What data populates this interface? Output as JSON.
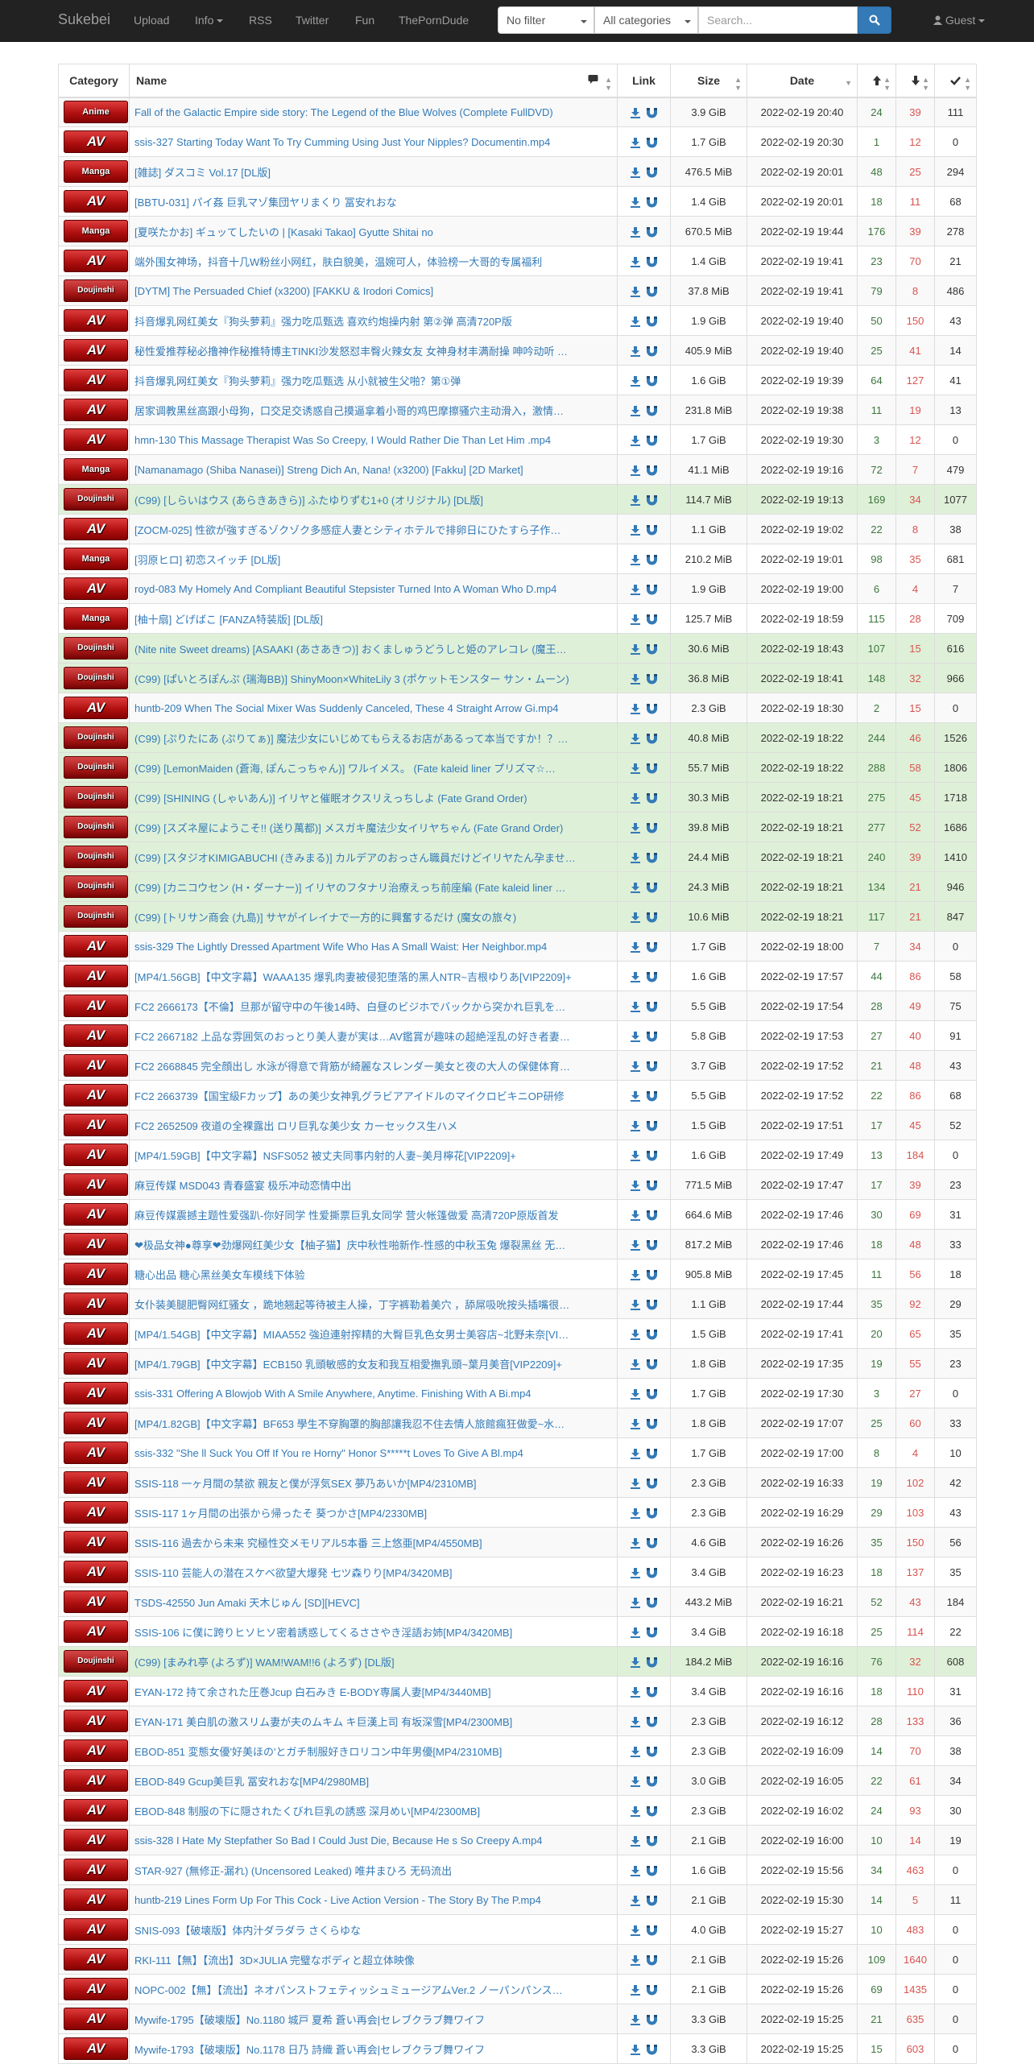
{
  "nav": {
    "brand": "Sukebei",
    "links": [
      "Upload",
      "Info",
      "RSS",
      "Twitter",
      "Fun",
      "ThePornDude"
    ],
    "filter": "No filter",
    "category": "All categories",
    "search_placeholder": "Search...",
    "user": "Guest"
  },
  "headers": {
    "category": "Category",
    "name": "Name",
    "link": "Link",
    "size": "Size",
    "date": "Date"
  },
  "colors": {
    "seeders": "#3c763d",
    "leechers": "#d9534f",
    "link": "#337ab7",
    "trusted_row": "#dff0d8"
  },
  "rows": [
    {
      "cat": "Anime",
      "name": "Fall of the Galactic Empire side story: The Legend of the Blue Wolves (Complete FullDVD)",
      "size": "3.9 GiB",
      "date": "2022-02-19 20:40",
      "s": "24",
      "l": "39",
      "c": "111",
      "trusted": false
    },
    {
      "cat": "AV",
      "name": "ssis-327 Starting Today Want To Try Cumming Using Just Your Nipples? Documentin.mp4",
      "size": "1.7 GiB",
      "date": "2022-02-19 20:30",
      "s": "1",
      "l": "12",
      "c": "0",
      "trusted": false
    },
    {
      "cat": "Manga",
      "name": "[雑誌] ダスコミ Vol.17 [DL版]",
      "size": "476.5 MiB",
      "date": "2022-02-19 20:01",
      "s": "48",
      "l": "25",
      "c": "294",
      "trusted": false
    },
    {
      "cat": "AV",
      "name": "[BBTU-031] パイ姦 巨乳マゾ集団ヤリまくり 冨安れおな",
      "size": "1.4 GiB",
      "date": "2022-02-19 20:01",
      "s": "18",
      "l": "11",
      "c": "68",
      "trusted": false
    },
    {
      "cat": "Manga",
      "name": "[夏咲たかお] ギュッてしたいの | [Kasaki Takao] Gyutte Shitai no",
      "size": "670.5 MiB",
      "date": "2022-02-19 19:44",
      "s": "176",
      "l": "39",
      "c": "278",
      "trusted": false
    },
    {
      "cat": "AV",
      "name": "端外围女神场，抖音十几W粉丝小网红，肤白貌美，温婉可人，体验榜一大哥的专属福利",
      "size": "1.4 GiB",
      "date": "2022-02-19 19:41",
      "s": "23",
      "l": "70",
      "c": "21",
      "trusted": false
    },
    {
      "cat": "Doujinshi",
      "name": "[DYTM] The Persuaded Chief (x3200) [FAKKU & Irodori Comics]",
      "size": "37.8 MiB",
      "date": "2022-02-19 19:41",
      "s": "79",
      "l": "8",
      "c": "486",
      "trusted": false
    },
    {
      "cat": "AV",
      "name": "抖音爆乳网红美女『狗头萝莉』强力吃瓜甄选 喜欢约炮操内射 第②弹 高清720P版",
      "size": "1.9 GiB",
      "date": "2022-02-19 19:40",
      "s": "50",
      "l": "150",
      "c": "43",
      "trusted": false
    },
    {
      "cat": "AV",
      "name": "秘性爱推荐秘必撸神作秘推特博主TINKI沙发怒怼丰臀火辣女友 女神身材丰满耐操 呻吟动听 …",
      "size": "405.9 MiB",
      "date": "2022-02-19 19:40",
      "s": "25",
      "l": "41",
      "c": "14",
      "trusted": false
    },
    {
      "cat": "AV",
      "name": "抖音爆乳网红美女『狗头萝莉』强力吃瓜甄选 从小就被生父啪？第①弹",
      "size": "1.6 GiB",
      "date": "2022-02-19 19:39",
      "s": "64",
      "l": "127",
      "c": "41",
      "trusted": false
    },
    {
      "cat": "AV",
      "name": "居家调教黑丝高跟小母狗，口交足交诱惑自己摸逼拿着小哥的鸡巴摩擦骚穴主动滑入，激情…",
      "size": "231.8 MiB",
      "date": "2022-02-19 19:38",
      "s": "11",
      "l": "19",
      "c": "13",
      "trusted": false
    },
    {
      "cat": "AV",
      "name": "hmn-130 This Massage Therapist Was So Creepy, I Would Rather Die Than Let Him .mp4",
      "size": "1.7 GiB",
      "date": "2022-02-19 19:30",
      "s": "3",
      "l": "12",
      "c": "0",
      "trusted": false
    },
    {
      "cat": "Manga",
      "name": "[Namanamago (Shiba Nanasei)] Streng Dich An, Nana! (x3200) [Fakku] [2D Market]",
      "size": "41.1 MiB",
      "date": "2022-02-19 19:16",
      "s": "72",
      "l": "7",
      "c": "479",
      "trusted": false
    },
    {
      "cat": "Doujinshi",
      "name": "(C99) [しらいはウス (あらきあきら)] ふたゆりずむ1+0 (オリジナル) [DL版]",
      "size": "114.7 MiB",
      "date": "2022-02-19 19:13",
      "s": "169",
      "l": "34",
      "c": "1077",
      "trusted": true
    },
    {
      "cat": "AV",
      "name": "[ZOCM-025] 性欲が強すぎるゾクゾク多感症人妻とシティホテルで排卵日にひたすら子作…",
      "size": "1.1 GiB",
      "date": "2022-02-19 19:02",
      "s": "22",
      "l": "8",
      "c": "38",
      "trusted": false
    },
    {
      "cat": "Manga",
      "name": "[羽原ヒロ] 初恋スイッチ [DL版]",
      "size": "210.2 MiB",
      "date": "2022-02-19 19:01",
      "s": "98",
      "l": "35",
      "c": "681",
      "trusted": false
    },
    {
      "cat": "AV",
      "name": "royd-083 My Homely And Compliant Beautiful Stepsister Turned Into A Woman Who D.mp4",
      "size": "1.9 GiB",
      "date": "2022-02-19 19:00",
      "s": "6",
      "l": "4",
      "c": "7",
      "trusted": false
    },
    {
      "cat": "Manga",
      "name": "[柚十扇] どげばこ [FANZA特装版] [DL版]",
      "size": "125.7 MiB",
      "date": "2022-02-19 18:59",
      "s": "115",
      "l": "28",
      "c": "709",
      "trusted": false
    },
    {
      "cat": "Doujinshi",
      "name": "(Nite nite Sweet dreams) [ASAAKI (あさあきつ)] おくましゅうどうしと姫のアレコレ (魔王…",
      "size": "30.6 MiB",
      "date": "2022-02-19 18:43",
      "s": "107",
      "l": "15",
      "c": "616",
      "trusted": true
    },
    {
      "cat": "Doujinshi",
      "name": "(C99) [ぱいとろぽんぷ (瑞海BB)] ShinyMoon×WhiteLily 3 (ポケットモンスター サン・ムーン)",
      "size": "36.8 MiB",
      "date": "2022-02-19 18:41",
      "s": "148",
      "l": "32",
      "c": "966",
      "trusted": true
    },
    {
      "cat": "AV",
      "name": "huntb-209 When The Social Mixer Was Suddenly Canceled, These 4 Straight Arrow Gi.mp4",
      "size": "2.3 GiB",
      "date": "2022-02-19 18:30",
      "s": "2",
      "l": "15",
      "c": "0",
      "trusted": false
    },
    {
      "cat": "Doujinshi",
      "name": "(C99) [ぷりたにあ (ぷりてぁ)] 魔法少女にいじめてもらえるお店があるって本当ですか！？…",
      "size": "40.8 MiB",
      "date": "2022-02-19 18:22",
      "s": "244",
      "l": "46",
      "c": "1526",
      "trusted": true
    },
    {
      "cat": "Doujinshi",
      "name": "(C99) [LemonMaiden (蒼海, ぽんこっちゃん)] ワルイメス。 (Fate kaleid liner プリズマ☆…",
      "size": "55.7 MiB",
      "date": "2022-02-19 18:22",
      "s": "288",
      "l": "58",
      "c": "1806",
      "trusted": true
    },
    {
      "cat": "Doujinshi",
      "name": "(C99) [SHINING (しゃいあん)] イリヤと催眠オクスリえっちしよ (Fate Grand Order)",
      "size": "30.3 MiB",
      "date": "2022-02-19 18:21",
      "s": "275",
      "l": "45",
      "c": "1718",
      "trusted": true
    },
    {
      "cat": "Doujinshi",
      "name": "(C99) [スズネ屋にようこそ!! (送り萬都)] メスガキ魔法少女イリヤちゃん (Fate Grand Order)",
      "size": "39.8 MiB",
      "date": "2022-02-19 18:21",
      "s": "277",
      "l": "52",
      "c": "1686",
      "trusted": true
    },
    {
      "cat": "Doujinshi",
      "name": "(C99) [スタジオKIMIGABUCHI (きみまる)] カルデアのおっさん職員だけどイリヤたん孕ませ…",
      "size": "24.4 MiB",
      "date": "2022-02-19 18:21",
      "s": "240",
      "l": "39",
      "c": "1410",
      "trusted": true
    },
    {
      "cat": "Doujinshi",
      "name": "(C99) [カニコウセン (H・ダーナー)] イリヤのフタナリ治療えっち前座編 (Fate kaleid liner …",
      "size": "24.3 MiB",
      "date": "2022-02-19 18:21",
      "s": "134",
      "l": "21",
      "c": "946",
      "trusted": true
    },
    {
      "cat": "Doujinshi",
      "name": "(C99) [トリサン商会 (九島)] サヤがイレイナで一方的に興奮するだけ (魔女の旅々)",
      "size": "10.6 MiB",
      "date": "2022-02-19 18:21",
      "s": "117",
      "l": "21",
      "c": "847",
      "trusted": true
    },
    {
      "cat": "AV",
      "name": "ssis-329 The Lightly Dressed Apartment Wife Who Has A Small Waist: Her Neighbor.mp4",
      "size": "1.7 GiB",
      "date": "2022-02-19 18:00",
      "s": "7",
      "l": "34",
      "c": "0",
      "trusted": false
    },
    {
      "cat": "AV",
      "name": "[MP4/1.56GB]【中文字幕】WAAA135 爆乳肉妻被侵犯堕落的黑人NTR~吉根ゆりあ[VIP2209]+",
      "size": "1.6 GiB",
      "date": "2022-02-19 17:57",
      "s": "44",
      "l": "86",
      "c": "58",
      "trusted": false
    },
    {
      "cat": "AV",
      "name": "FC2 2666173【不倫】旦那が留守中の午後14時、白昼のビジホでバックから突かれ巨乳を…",
      "size": "5.5 GiB",
      "date": "2022-02-19 17:54",
      "s": "28",
      "l": "49",
      "c": "75",
      "trusted": false
    },
    {
      "cat": "AV",
      "name": "FC2 2667182 上品な雰囲気のおっとり美人妻が実は…AV鑑賞が趣味の超絶淫乱の好き者妻…",
      "size": "5.8 GiB",
      "date": "2022-02-19 17:53",
      "s": "27",
      "l": "40",
      "c": "91",
      "trusted": false
    },
    {
      "cat": "AV",
      "name": "FC2 2668845 完全顔出し 水泳が得意で背筋が綺麗なスレンダー美女と夜の大人の保健体育…",
      "size": "3.7 GiB",
      "date": "2022-02-19 17:52",
      "s": "21",
      "l": "48",
      "c": "43",
      "trusted": false
    },
    {
      "cat": "AV",
      "name": "FC2 2663739【国宝級Fカップ】あの美少女神乳グラビアアイドルのマイクロビキニOP研修",
      "size": "5.5 GiB",
      "date": "2022-02-19 17:52",
      "s": "22",
      "l": "86",
      "c": "68",
      "trusted": false
    },
    {
      "cat": "AV",
      "name": "FC2 2652509 夜道の全裸露出 ロリ巨乳な美少女 カーセックス生ハメ",
      "size": "1.5 GiB",
      "date": "2022-02-19 17:51",
      "s": "17",
      "l": "45",
      "c": "52",
      "trusted": false
    },
    {
      "cat": "AV",
      "name": "[MP4/1.59GB]【中文字幕】NSFS052 被丈夫同事内射的人妻~美月檸花[VIP2209]+",
      "size": "1.6 GiB",
      "date": "2022-02-19 17:49",
      "s": "13",
      "l": "184",
      "c": "0",
      "trusted": false
    },
    {
      "cat": "AV",
      "name": "麻豆传媒 MSD043 青春盛宴 极乐冲动恋情中出",
      "size": "771.5 MiB",
      "date": "2022-02-19 17:47",
      "s": "17",
      "l": "39",
      "c": "23",
      "trusted": false
    },
    {
      "cat": "AV",
      "name": "麻豆传媒震撼主题性爱强趴-你好同学 性爱撕票巨乳女同学 营火帐篷做爱 高清720P原版首发",
      "size": "664.6 MiB",
      "date": "2022-02-19 17:46",
      "s": "30",
      "l": "69",
      "c": "31",
      "trusted": false
    },
    {
      "cat": "AV",
      "name": "❤极品女神●尊享❤劲爆网红美少女【柚子猫】庆中秋性啪新作-性感的中秋玉兔 爆裂黑丝 无…",
      "size": "817.2 MiB",
      "date": "2022-02-19 17:46",
      "s": "18",
      "l": "48",
      "c": "33",
      "trusted": false
    },
    {
      "cat": "AV",
      "name": "糖心出品 糖心黑丝美女车模线下体验",
      "size": "905.8 MiB",
      "date": "2022-02-19 17:45",
      "s": "11",
      "l": "56",
      "c": "18",
      "trusted": false
    },
    {
      "cat": "AV",
      "name": "女仆装美腿肥臀网红骚女 ，跪地翘起等待被主人操，丁字裤勒着美穴 ，舔屌吸吮按头插嘴很…",
      "size": "1.1 GiB",
      "date": "2022-02-19 17:44",
      "s": "35",
      "l": "92",
      "c": "29",
      "trusted": false
    },
    {
      "cat": "AV",
      "name": "[MP4/1.54GB]【中文字幕】MIAA552 強迫連射搾精的大臀巨乳色女男士美容店~北野未奈[VI…",
      "size": "1.5 GiB",
      "date": "2022-02-19 17:41",
      "s": "20",
      "l": "65",
      "c": "35",
      "trusted": false
    },
    {
      "cat": "AV",
      "name": "[MP4/1.79GB]【中文字幕】ECB150 乳頭敏感的女友和我互相愛撫乳頭~葉月美音[VIP2209]+",
      "size": "1.8 GiB",
      "date": "2022-02-19 17:35",
      "s": "19",
      "l": "55",
      "c": "23",
      "trusted": false
    },
    {
      "cat": "AV",
      "name": "ssis-331 Offering A Blowjob With A Smile Anywhere, Anytime. Finishing With A Bi.mp4",
      "size": "1.7 GiB",
      "date": "2022-02-19 17:30",
      "s": "3",
      "l": "27",
      "c": "0",
      "trusted": false
    },
    {
      "cat": "AV",
      "name": "[MP4/1.82GB]【中文字幕】BF653 學生不穿胸罩的胸部讓我忍不住去情人旅館瘋狂做愛~水…",
      "size": "1.8 GiB",
      "date": "2022-02-19 17:07",
      "s": "25",
      "l": "60",
      "c": "33",
      "trusted": false
    },
    {
      "cat": "AV",
      "name": "ssis-332 \"She ll Suck You Off If You re Horny\" Honor S*****t Loves To Give A Bl.mp4",
      "size": "1.7 GiB",
      "date": "2022-02-19 17:00",
      "s": "8",
      "l": "4",
      "c": "10",
      "trusted": false
    },
    {
      "cat": "AV",
      "name": "SSIS-118 一ヶ月間の禁欲 親友と僕が浮気SEX 夢乃あいか[MP4/2310MB]",
      "size": "2.3 GiB",
      "date": "2022-02-19 16:33",
      "s": "19",
      "l": "102",
      "c": "42",
      "trusted": false
    },
    {
      "cat": "AV",
      "name": "SSIS-117 1ヶ月間の出張から帰ったそ 葵つかさ[MP4/2330MB]",
      "size": "2.3 GiB",
      "date": "2022-02-19 16:29",
      "s": "29",
      "l": "103",
      "c": "43",
      "trusted": false
    },
    {
      "cat": "AV",
      "name": "SSIS-116 過去から未来 究極性交メモリアル5本番 三上悠亜[MP4/4550MB]",
      "size": "4.6 GiB",
      "date": "2022-02-19 16:26",
      "s": "35",
      "l": "150",
      "c": "56",
      "trusted": false
    },
    {
      "cat": "AV",
      "name": "SSIS-110 芸能人の潜在スケベ欲望大爆発 七ツ森りり[MP4/3420MB]",
      "size": "3.4 GiB",
      "date": "2022-02-19 16:23",
      "s": "18",
      "l": "137",
      "c": "35",
      "trusted": false
    },
    {
      "cat": "AV",
      "name": "TSDS-42550 Jun Amaki 天木じゅん [SD][HEVC]",
      "size": "443.2 MiB",
      "date": "2022-02-19 16:21",
      "s": "52",
      "l": "43",
      "c": "184",
      "trusted": false
    },
    {
      "cat": "AV",
      "name": "SSIS-106 に僕に跨りヒソヒソ密着誘惑してくるささやき淫語お姉[MP4/3420MB]",
      "size": "3.4 GiB",
      "date": "2022-02-19 16:18",
      "s": "25",
      "l": "114",
      "c": "22",
      "trusted": false
    },
    {
      "cat": "Doujinshi",
      "name": "(C99) [まみれ亭 (よろず)] WAM!WAM!!6 (よろず) [DL版]",
      "size": "184.2 MiB",
      "date": "2022-02-19 16:16",
      "s": "76",
      "l": "32",
      "c": "608",
      "trusted": true
    },
    {
      "cat": "AV",
      "name": "EYAN-172 持て余された圧巻Jcup 白石みき E-BODY専属人妻[MP4/3440MB]",
      "size": "3.4 GiB",
      "date": "2022-02-19 16:16",
      "s": "18",
      "l": "110",
      "c": "31",
      "trusted": false
    },
    {
      "cat": "AV",
      "name": "EYAN-171 美白肌の激スリム妻が夫のムキム キ巨漢上司 有坂深雪[MP4/2300MB]",
      "size": "2.3 GiB",
      "date": "2022-02-19 16:12",
      "s": "28",
      "l": "133",
      "c": "36",
      "trusted": false
    },
    {
      "cat": "AV",
      "name": "EBOD-851 変態女優'好美ほの'とガチ制服好きロリコン中年男優[MP4/2310MB]",
      "size": "2.3 GiB",
      "date": "2022-02-19 16:09",
      "s": "14",
      "l": "70",
      "c": "38",
      "trusted": false
    },
    {
      "cat": "AV",
      "name": "EBOD-849 Gcup美巨乳 冨安れおな[MP4/2980MB]",
      "size": "3.0 GiB",
      "date": "2022-02-19 16:05",
      "s": "22",
      "l": "61",
      "c": "34",
      "trusted": false
    },
    {
      "cat": "AV",
      "name": "EBOD-848 制服の下に隠されたくびれ巨乳の誘惑 深月めい[MP4/2300MB]",
      "size": "2.3 GiB",
      "date": "2022-02-19 16:02",
      "s": "24",
      "l": "93",
      "c": "30",
      "trusted": false
    },
    {
      "cat": "AV",
      "name": "ssis-328 I Hate My Stepfather So Bad I Could Just Die, Because He s So Creepy A.mp4",
      "size": "2.1 GiB",
      "date": "2022-02-19 16:00",
      "s": "10",
      "l": "14",
      "c": "19",
      "trusted": false
    },
    {
      "cat": "AV",
      "name": "STAR-927 (無修正-漏れ) (Uncensored Leaked) 唯井まひろ 无码流出",
      "size": "1.6 GiB",
      "date": "2022-02-19 15:56",
      "s": "34",
      "l": "463",
      "c": "0",
      "trusted": false
    },
    {
      "cat": "AV",
      "name": "huntb-219 Lines Form Up For This Cock - Live Action Version - The Story By The P.mp4",
      "size": "2.1 GiB",
      "date": "2022-02-19 15:30",
      "s": "14",
      "l": "5",
      "c": "11",
      "trusted": false
    },
    {
      "cat": "AV",
      "name": "SNIS-093【破壊版】体内汁ダラダラ さくらゆな",
      "size": "4.0 GiB",
      "date": "2022-02-19 15:27",
      "s": "10",
      "l": "483",
      "c": "0",
      "trusted": false
    },
    {
      "cat": "AV",
      "name": "RKI-111【無】【流出】3D×JULIA 完璧なボディと超立体映像",
      "size": "2.1 GiB",
      "date": "2022-02-19 15:26",
      "s": "109",
      "l": "1640",
      "c": "0",
      "trusted": false
    },
    {
      "cat": "AV",
      "name": "NOPC-002【無】【流出】ネオパンストフェティッシュミュージアムVer.2 ノーパンパンス…",
      "size": "2.1 GiB",
      "date": "2022-02-19 15:26",
      "s": "69",
      "l": "1435",
      "c": "0",
      "trusted": false
    },
    {
      "cat": "AV",
      "name": "Mywife-1795【破壊版】No.1180 城戸 夏希 蒼い再会|セレブクラブ舞ワイフ",
      "size": "3.3 GiB",
      "date": "2022-02-19 15:25",
      "s": "21",
      "l": "635",
      "c": "0",
      "trusted": false
    },
    {
      "cat": "AV",
      "name": "Mywife-1793【破壊版】No.1178 日乃 詩織 蒼い再会|セレブクラブ舞ワイフ",
      "size": "3.3 GiB",
      "date": "2022-02-19 15:25",
      "s": "15",
      "l": "603",
      "c": "0",
      "trusted": false
    }
  ]
}
